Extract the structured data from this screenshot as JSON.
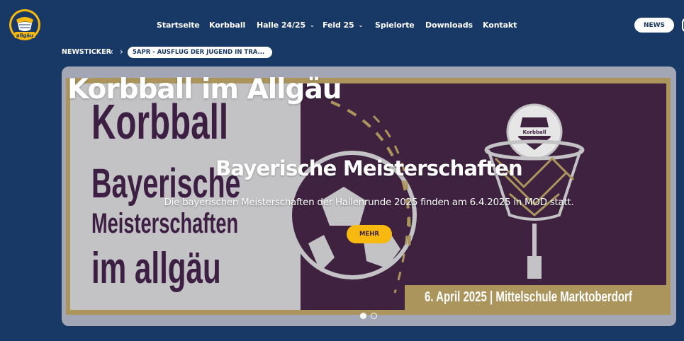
{
  "nav": {
    "items": [
      {
        "label": "Startseite",
        "dropdown": false
      },
      {
        "label": "Korbball",
        "dropdown": false
      },
      {
        "label": "Halle 24/25",
        "dropdown": true
      },
      {
        "label": "Feld 25",
        "dropdown": true
      },
      {
        "label": "Spielorte",
        "dropdown": false
      },
      {
        "label": "Downloads",
        "dropdown": false
      },
      {
        "label": "Kontakt",
        "dropdown": false
      }
    ],
    "news_button": "NEWS",
    "chevron": "⌄"
  },
  "logo": {
    "text": "allgäu",
    "icon": "korbball-logo-icon"
  },
  "ticker": {
    "label": "NEWSTICKER",
    "prev": "‹",
    "next": "›",
    "item": "5APR - AUSFLUG DER JUGEND IN TRA..."
  },
  "hero": {
    "site_title": "Korbball im Allgäu",
    "slide_title": "Bayerische Meisterschaften",
    "slide_text": "Die bayerischen Meisterschaften der Hallenrunde 2025 finden am 6.4.2025 in MOD statt.",
    "more_button": "MEHR",
    "poster": {
      "line1": "Korbball",
      "line2": "Bayerische",
      "line3": "Meisterschaften",
      "line4": "im allgäu",
      "footer": "6. April 2025  |  Mittelschule Marktoberdorf",
      "ball_label": "Korbball"
    },
    "slides": 2,
    "active_slide": 1
  },
  "colors": {
    "background": "#183866",
    "accent": "#f7b90f",
    "poster_purple": "#3e2240",
    "poster_gold": "#ab955c"
  }
}
